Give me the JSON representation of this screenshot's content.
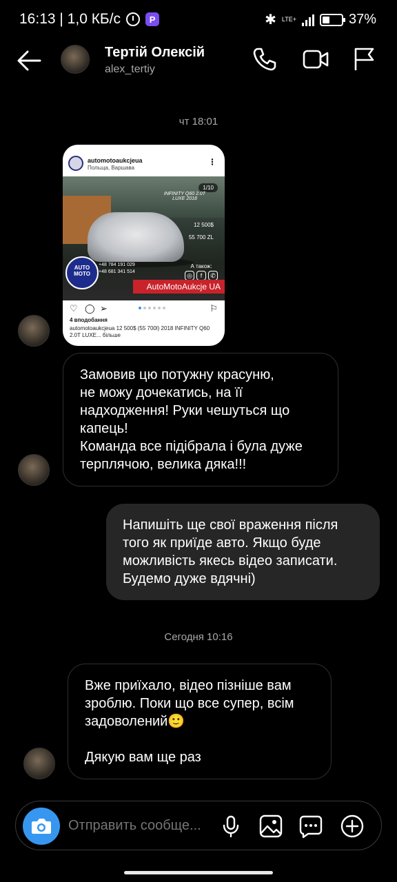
{
  "status_bar": {
    "time_speed": "16:13 | 1,0 КБ/с",
    "app_badge": "P",
    "network": "LTE+",
    "battery_percent": "37%",
    "battery_level": 0.37
  },
  "header": {
    "name": "Тертій Олексій",
    "username": "alex_tertiy"
  },
  "timestamps": [
    "чт 18:01",
    "Сегодня 10:16"
  ],
  "shared_post": {
    "account": "automotoaukcjeua",
    "location": "Польща, Варшава",
    "counter": "1/10",
    "model_text": "INFINITY Q60 2.0T LUXE 2018",
    "price_usd": "12 500$",
    "price_zl": "55 700 ZL",
    "phones": [
      "+48 784 191 029",
      "+48 681 341 514"
    ],
    "badge_text": "AUTO MOTO",
    "social_label": "А також:",
    "brand_label": "AutoMotoAukcje UA",
    "likes": "4 вподобання",
    "caption": "automotoaukcjeua 12 500$ (55 700l) 2018 INFINITY Q60 2.0T LUXE... більше"
  },
  "messages": [
    {
      "direction": "in",
      "text": "Замовив цю потужну красуню,\nне можу дочекатись, на її\nнадходження! Руки чешуться що\nкапець!\nКоманда все підібрала і була дуже\nтерплячою, велика дяка!!!"
    },
    {
      "direction": "out",
      "text": "Напишіть ще свої враження після\nтого як приїде авто. Якщо буде\nможливість якесь відео записати.\nБудемо дуже вдячні)"
    },
    {
      "direction": "in",
      "text": "Вже приїхало, відео пізніше вам\nзроблю. Поки що все супер, всім\nзадоволений🙂\n\nДякую вам ще раз"
    }
  ],
  "composer": {
    "placeholder": "Отправить сообще..."
  },
  "colors": {
    "background": "#000000",
    "outgoing_bubble": "#262626",
    "accent_blue": "#3797f0",
    "brand_red": "#c8232b"
  }
}
